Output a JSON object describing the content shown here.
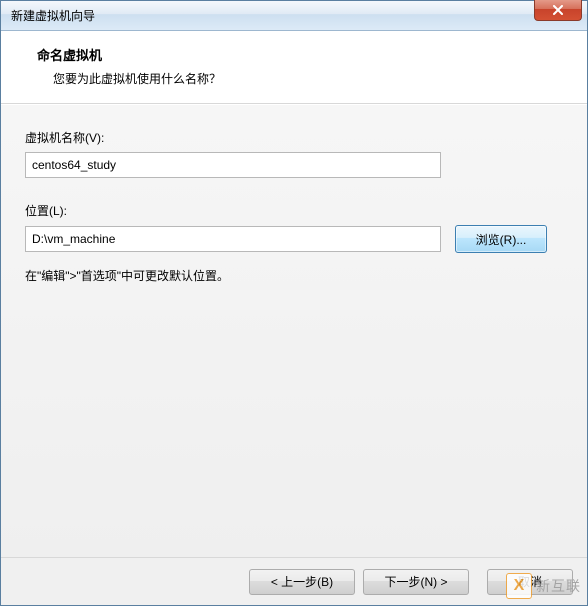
{
  "window": {
    "title": "新建虚拟机向导"
  },
  "header": {
    "title": "命名虚拟机",
    "subtitle": "您要为此虚拟机使用什么名称？"
  },
  "fields": {
    "name_label": "虚拟机名称(V):",
    "name_value": "centos64_study",
    "location_label": "位置(L):",
    "location_value": "D:\\vm_machine",
    "browse_label": "浏览(R)...",
    "hint": "在\"编辑\">\"首选项\"中可更改默认位置。"
  },
  "footer": {
    "back": "< 上一步(B)",
    "next": "下一步(N) >",
    "cancel": "取消"
  },
  "watermark": {
    "logo": "X",
    "text": "新互联"
  },
  "colors": {
    "title_border": "#5a7fa0",
    "close_bg": "#c8432b",
    "browse_border": "#3c7fb1"
  }
}
